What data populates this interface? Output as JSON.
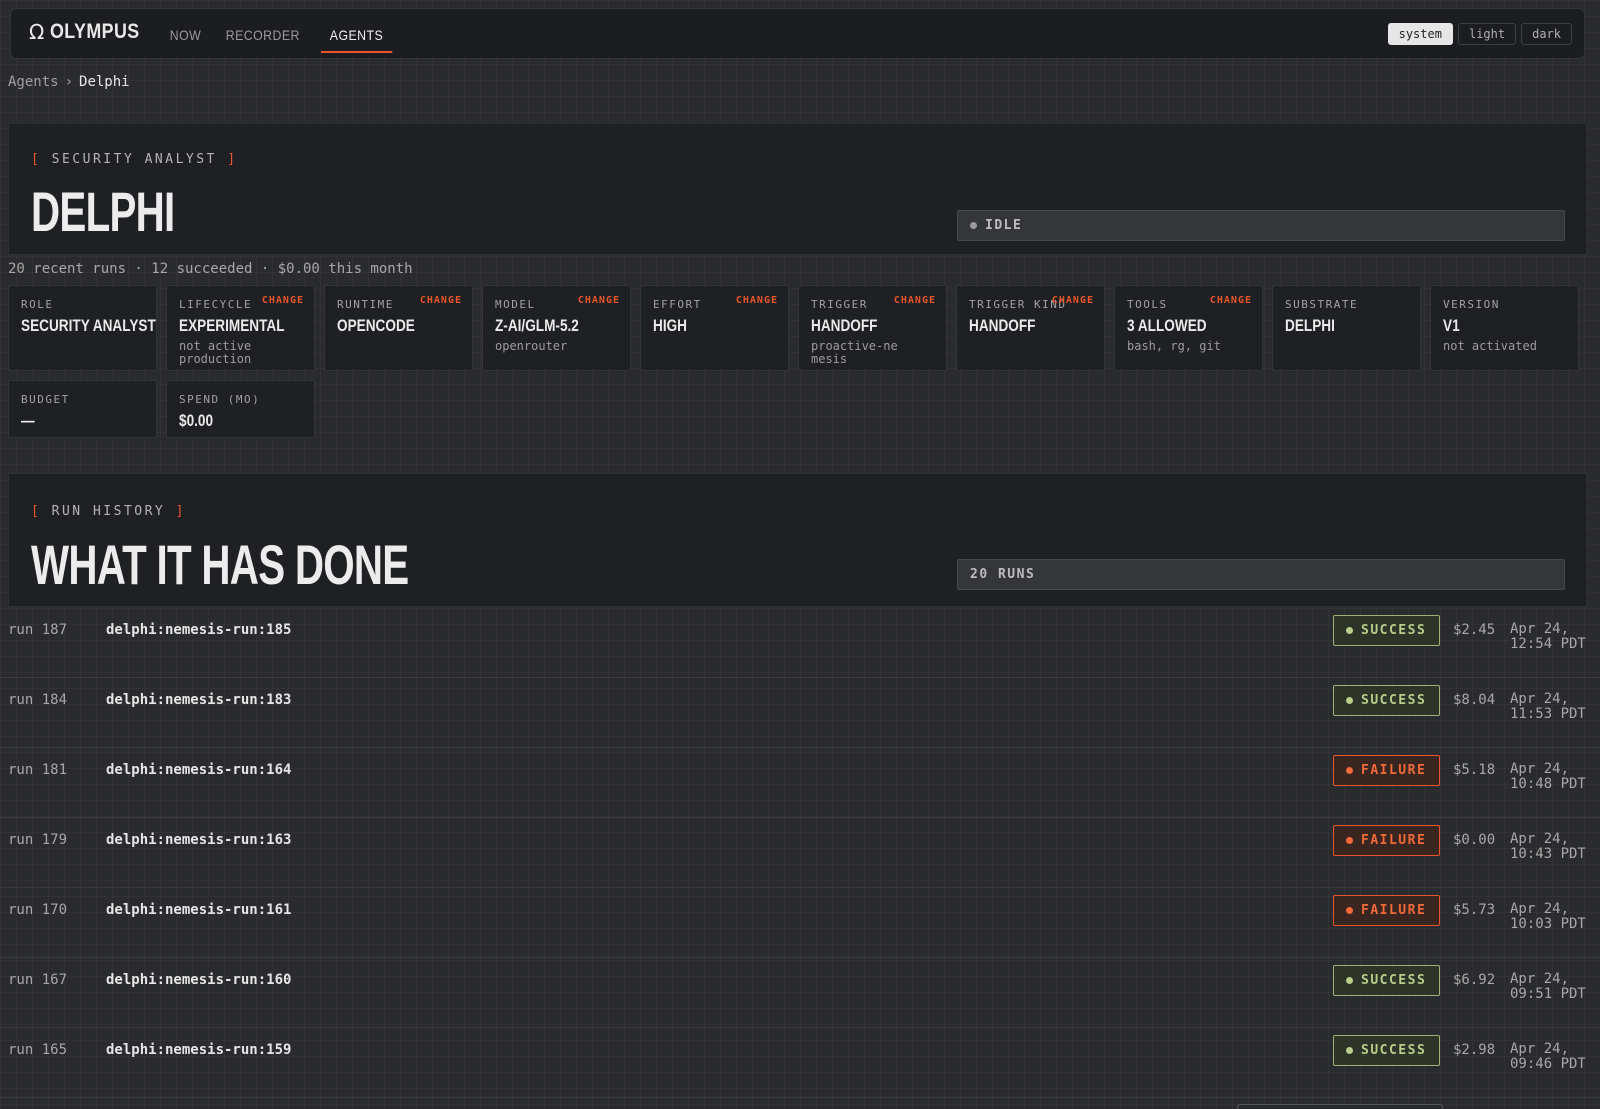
{
  "app": {
    "logo_icon": "Ω",
    "name": "OLYMPUS"
  },
  "nav": [
    {
      "label": "NOW",
      "active": false
    },
    {
      "label": "RECORDER",
      "active": false
    },
    {
      "label": "AGENTS",
      "active": true
    }
  ],
  "theme": {
    "options": [
      "system",
      "light",
      "dark"
    ],
    "selected": "system"
  },
  "breadcrumb": {
    "parent": "Agents",
    "separator": "›",
    "current": "Delphi"
  },
  "agent": {
    "eyebrow": "SECURITY ANALYST",
    "name": "DELPHI",
    "status": "IDLE",
    "summary": "20 recent runs · 12 succeeded · $0.00 this month"
  },
  "change_label": "CHANGE",
  "attributes": [
    {
      "label": "ROLE",
      "value": "SECURITY ANALYST",
      "sub": "",
      "changeable": false
    },
    {
      "label": "LIFECYCLE",
      "value": "EXPERIMENTAL",
      "sub": "not active production",
      "changeable": true
    },
    {
      "label": "RUNTIME",
      "value": "OPENCODE",
      "sub": "",
      "changeable": true
    },
    {
      "label": "MODEL",
      "value": "Z-AI/GLM-5.2",
      "sub": "openrouter",
      "changeable": true
    },
    {
      "label": "EFFORT",
      "value": "HIGH",
      "sub": "",
      "changeable": true
    },
    {
      "label": "TRIGGER",
      "value": "HANDOFF",
      "sub": "proactive-nemesis",
      "changeable": true
    },
    {
      "label": "TRIGGER KIND",
      "value": "HANDOFF",
      "sub": "",
      "changeable": true
    },
    {
      "label": "TOOLS",
      "value": "3 ALLOWED",
      "sub": "bash, rg, git",
      "changeable": true
    },
    {
      "label": "SUBSTRATE",
      "value": "DELPHI",
      "sub": "",
      "changeable": false
    },
    {
      "label": "VERSION",
      "value": "V1",
      "sub": "not activated",
      "changeable": false
    },
    {
      "label": "BUDGET",
      "value": "—",
      "sub": "",
      "changeable": false
    },
    {
      "label": "SPEND (MO)",
      "value": "$0.00",
      "sub": "",
      "changeable": false
    }
  ],
  "run_history": {
    "eyebrow": "RUN HISTORY",
    "title": "WHAT IT HAS DONE",
    "count_label": "20 RUNS",
    "runs": [
      {
        "num": "run 187",
        "name": "delphi:nemesis-run:185",
        "status": "SUCCESS",
        "cost": "$2.45",
        "time": "Apr 24, 12:54 PDT"
      },
      {
        "num": "run 184",
        "name": "delphi:nemesis-run:183",
        "status": "SUCCESS",
        "cost": "$8.04",
        "time": "Apr 24, 11:53 PDT"
      },
      {
        "num": "run 181",
        "name": "delphi:nemesis-run:164",
        "status": "FAILURE",
        "cost": "$5.18",
        "time": "Apr 24, 10:48 PDT"
      },
      {
        "num": "run 179",
        "name": "delphi:nemesis-run:163",
        "status": "FAILURE",
        "cost": "$0.00",
        "time": "Apr 24, 10:43 PDT"
      },
      {
        "num": "run 170",
        "name": "delphi:nemesis-run:161",
        "status": "FAILURE",
        "cost": "$5.73",
        "time": "Apr 24, 10:03 PDT"
      },
      {
        "num": "run 167",
        "name": "delphi:nemesis-run:160",
        "status": "SUCCESS",
        "cost": "$6.92",
        "time": "Apr 24, 09:51 PDT"
      },
      {
        "num": "run 165",
        "name": "delphi:nemesis-run:159",
        "status": "SUCCESS",
        "cost": "$2.98",
        "time": "Apr 24, 09:46 PDT"
      }
    ]
  },
  "colors": {
    "accent": "#e8552a",
    "success": "#b9cd8d",
    "failure": "#f06a3a",
    "background": "#2a2b2e"
  }
}
